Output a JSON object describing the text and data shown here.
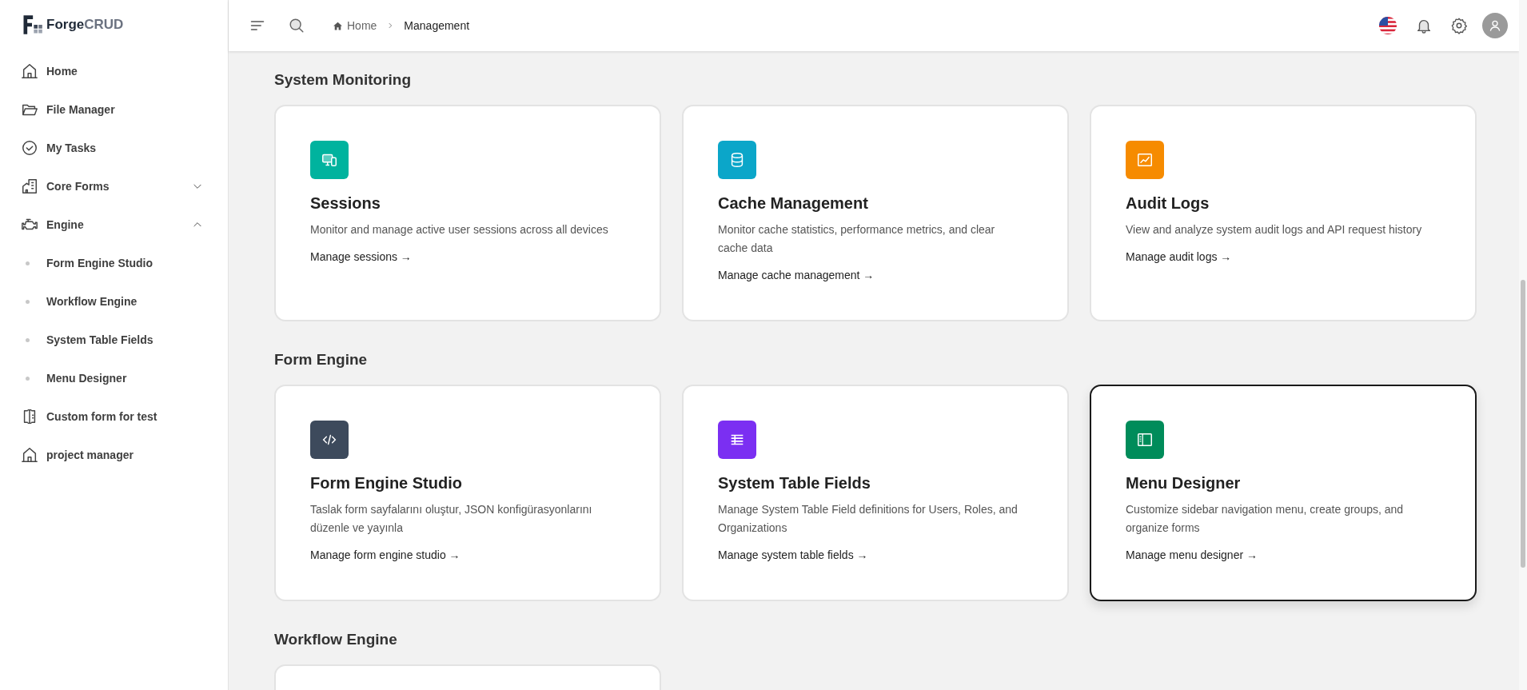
{
  "brand": {
    "part_1": "Forge",
    "part_2": "CRUD"
  },
  "sidebar": {
    "items": [
      {
        "label": "Home",
        "kind": "house"
      },
      {
        "label": "File Manager",
        "kind": "folder"
      },
      {
        "label": "My Tasks",
        "kind": "check"
      },
      {
        "label": "Core Forms",
        "kind": "building",
        "expanded": false
      },
      {
        "label": "Engine",
        "kind": "engine",
        "expanded": true,
        "children": [
          {
            "label": "Form Engine Studio"
          },
          {
            "label": "Workflow Engine"
          },
          {
            "label": "System Table Fields"
          },
          {
            "label": "Menu Designer"
          }
        ]
      },
      {
        "label": "Custom form for test",
        "kind": "form"
      },
      {
        "label": "project manager",
        "kind": "house"
      }
    ]
  },
  "breadcrumb": [
    {
      "label": "Home"
    },
    {
      "label": "Management"
    }
  ],
  "sections": [
    {
      "title": "System Monitoring",
      "cards": [
        {
          "kind": "devices",
          "color": "#00b39e",
          "title": "Sessions",
          "description": "Monitor and manage active user sessions across all devices",
          "link": "Manage sessions →",
          "selected": false
        },
        {
          "kind": "database",
          "color": "#0ba6c9",
          "title": "Cache Management",
          "description": "Monitor cache statistics, performance metrics, and clear cache data",
          "link": "Manage cache management →",
          "selected": false
        },
        {
          "kind": "chart",
          "color": "#f68b00",
          "title": "Audit Logs",
          "description": "View and analyze system audit logs and API request history",
          "link": "Manage audit logs →",
          "selected": false
        }
      ]
    },
    {
      "title": "Form Engine",
      "cards": [
        {
          "kind": "code",
          "color": "#3d4a5c",
          "title": "Form Engine Studio",
          "description": "Taslak form sayfalarını oluştur, JSON konfigürasyonlarını düzenle ve yayınla",
          "link": "Manage form engine studio →",
          "selected": false
        },
        {
          "kind": "table",
          "color": "#7b2ff2",
          "title": "System Table Fields",
          "description": "Manage System Table Field definitions for Users, Roles, and Organizations",
          "link": "Manage system table fields →",
          "selected": false
        },
        {
          "kind": "sidebar",
          "color": "#008c5a",
          "title": "Menu Designer",
          "description": "Customize sidebar navigation menu, create groups, and organize forms",
          "link": "Manage menu designer →",
          "selected": true
        }
      ]
    },
    {
      "title": "Workflow Engine",
      "cards": [
        {
          "kind": "cut"
        }
      ]
    }
  ]
}
